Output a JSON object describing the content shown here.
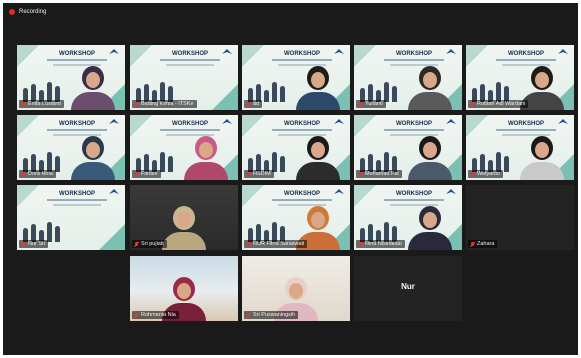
{
  "recording": {
    "label": "Recording",
    "color": "#d9302c"
  },
  "slide_title": "WORKSHOP",
  "colors": {
    "active_border": "#f2e33a",
    "mute": "#e03a3a",
    "background": "#1a1a1a"
  },
  "tiles": [
    {
      "name": "Erlita Lusianti",
      "kind": "slide_person"
    },
    {
      "name": "Bidang Kimia - ITSKe",
      "kind": "slide",
      "active": true
    },
    {
      "name": "ad",
      "kind": "slide_person"
    },
    {
      "name": "Yulianti",
      "kind": "slide_person"
    },
    {
      "name": "Robiah Adi Wardani",
      "kind": "slide_person"
    },
    {
      "name": "Dora Hiria",
      "kind": "slide_person"
    },
    {
      "name": "Fitriani",
      "kind": "slide_person"
    },
    {
      "name": "HSDIM",
      "kind": "slide_person"
    },
    {
      "name": "Mohamad Fai",
      "kind": "slide_person"
    },
    {
      "name": "Widyanto",
      "kind": "slide_person"
    },
    {
      "name": "Nur Sh",
      "kind": "slide"
    },
    {
      "name": "Sri pujiati",
      "kind": "person"
    },
    {
      "name": "NUR Fitria Saraswati",
      "kind": "slide_person"
    },
    {
      "name": "Nina Nisinaidai",
      "kind": "slide_person"
    },
    {
      "name": "Zahara",
      "kind": "empty"
    },
    {
      "name": "Rohmania Nia",
      "kind": "photo_beach"
    },
    {
      "name": "Sri Puswaningsih",
      "kind": "photo_room"
    },
    {
      "name": "Nur",
      "kind": "text_only"
    }
  ]
}
